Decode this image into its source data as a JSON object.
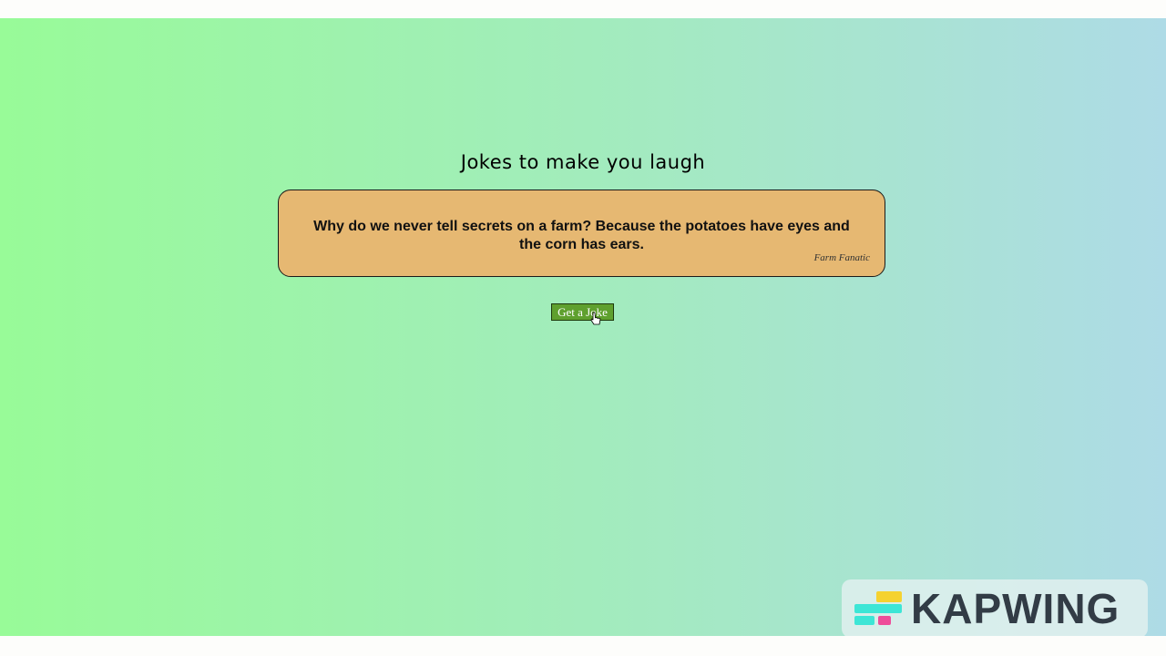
{
  "page": {
    "title": "Jokes to make you laugh"
  },
  "joke": {
    "text": "Why do we never tell secrets on a farm? Because the potatoes have eyes and the corn has ears.",
    "author": "Farm Fanatic"
  },
  "controls": {
    "get_joke_label": "Get a Joke"
  },
  "watermark": {
    "text": "KAPWING",
    "logo_icon": "kapwing-logo-icon"
  },
  "colors": {
    "gradient_start": "#98fb98",
    "gradient_end": "#aedbe6",
    "card_background": "#e6b872",
    "button_background": "#5fa02e"
  },
  "cursor": {
    "icon": "pointer-hand-icon"
  }
}
